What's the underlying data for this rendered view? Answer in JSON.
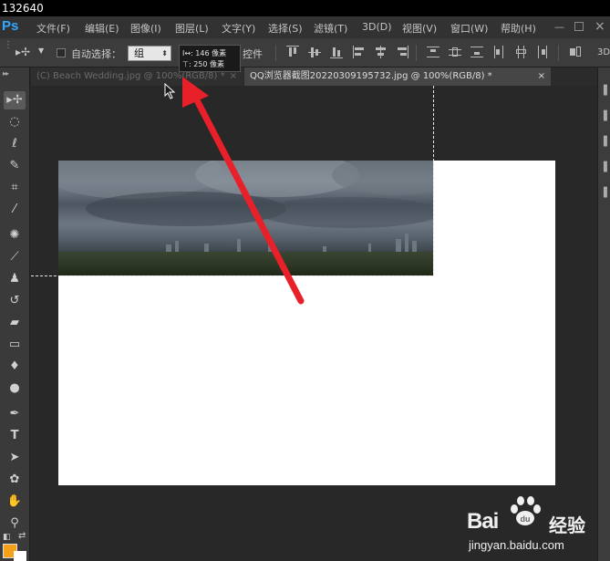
{
  "top_counter": "132640",
  "app": {
    "logo": "Ps"
  },
  "menu": [
    "文件(F)",
    "编辑(E)",
    "图像(I)",
    "图层(L)",
    "文字(Y)",
    "选择(S)",
    "滤镜(T)",
    "3D(D)",
    "视图(V)",
    "窗口(W)",
    "帮助(H)"
  ],
  "options": {
    "auto_select_label": "自动选择：",
    "auto_select_value": "组",
    "transform_controls_label": "控件",
    "right_edge_label": "3D"
  },
  "tooltip": {
    "line1": "I↔: 146 像素",
    "line2": "⊤: 250 像素"
  },
  "tabs": [
    {
      "label": "(C) Beach Wedding.jpg @ 100%(RGB/8) *",
      "close": "×"
    },
    {
      "label": "QQ浏览器截图20220309195732.jpg @ 100%(RGB/8) *",
      "close": "×"
    }
  ],
  "colors": {
    "foreground": "#f5a01a",
    "background": "#ffffff",
    "annotation_arrow": "#e8202a"
  },
  "tools": [
    "move-tool",
    "marquee-tool",
    "lasso-tool",
    "quick-select-tool",
    "crop-tool",
    "eyedropper-tool",
    "healing-tool",
    "brush-tool",
    "stamp-tool",
    "history-brush-tool",
    "eraser-tool",
    "gradient-tool",
    "blur-tool",
    "dodge-tool",
    "pen-tool",
    "type-tool",
    "path-select-tool",
    "shape-tool",
    "hand-tool",
    "zoom-tool"
  ],
  "watermark": {
    "brand_text": "Bai",
    "brand_du": "du",
    "jingyan": "经验",
    "url": "jingyan.baidu.com"
  }
}
